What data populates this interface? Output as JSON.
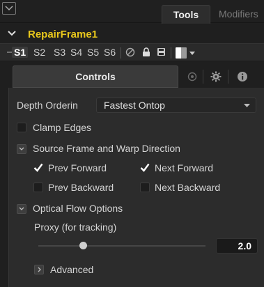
{
  "tabs": {
    "tools": "Tools",
    "modifiers": "Modifiers"
  },
  "node": {
    "name": "RepairFrame1"
  },
  "scenes": [
    "S1",
    "S2",
    "S3",
    "S4",
    "S5",
    "S6"
  ],
  "active_scene": "S1",
  "sub_tabs": {
    "controls": "Controls"
  },
  "controls": {
    "depth_ordering_label": "Depth Orderin",
    "depth_ordering_value": "Fastest Ontop",
    "clamp_edges_label": "Clamp Edges",
    "source_frame_section": "Source Frame and Warp Direction",
    "prev_forward": "Prev Forward",
    "next_forward": "Next Forward",
    "prev_backward": "Prev Backward",
    "next_backward": "Next Backward",
    "optical_flow_section": "Optical Flow Options",
    "proxy_label": "Proxy (for tracking)",
    "proxy_value": "2.0",
    "proxy_slider_fraction": 0.27,
    "advanced_label": "Advanced"
  },
  "state": {
    "clamp_edges": false,
    "prev_forward": true,
    "next_forward": true,
    "prev_backward": false,
    "next_backward": false
  },
  "colors": {
    "node_name": "#e9c81c",
    "background": "#2c2c2c"
  },
  "icons": [
    "collapse-icon",
    "chevron-down-icon",
    "pin-icon",
    "disable-icon",
    "lock-icon",
    "save-icon",
    "color-swatch-icon",
    "link-icon",
    "gear-icon",
    "info-icon",
    "caret-down-icon",
    "checkmark-icon",
    "chevron-right-icon"
  ]
}
